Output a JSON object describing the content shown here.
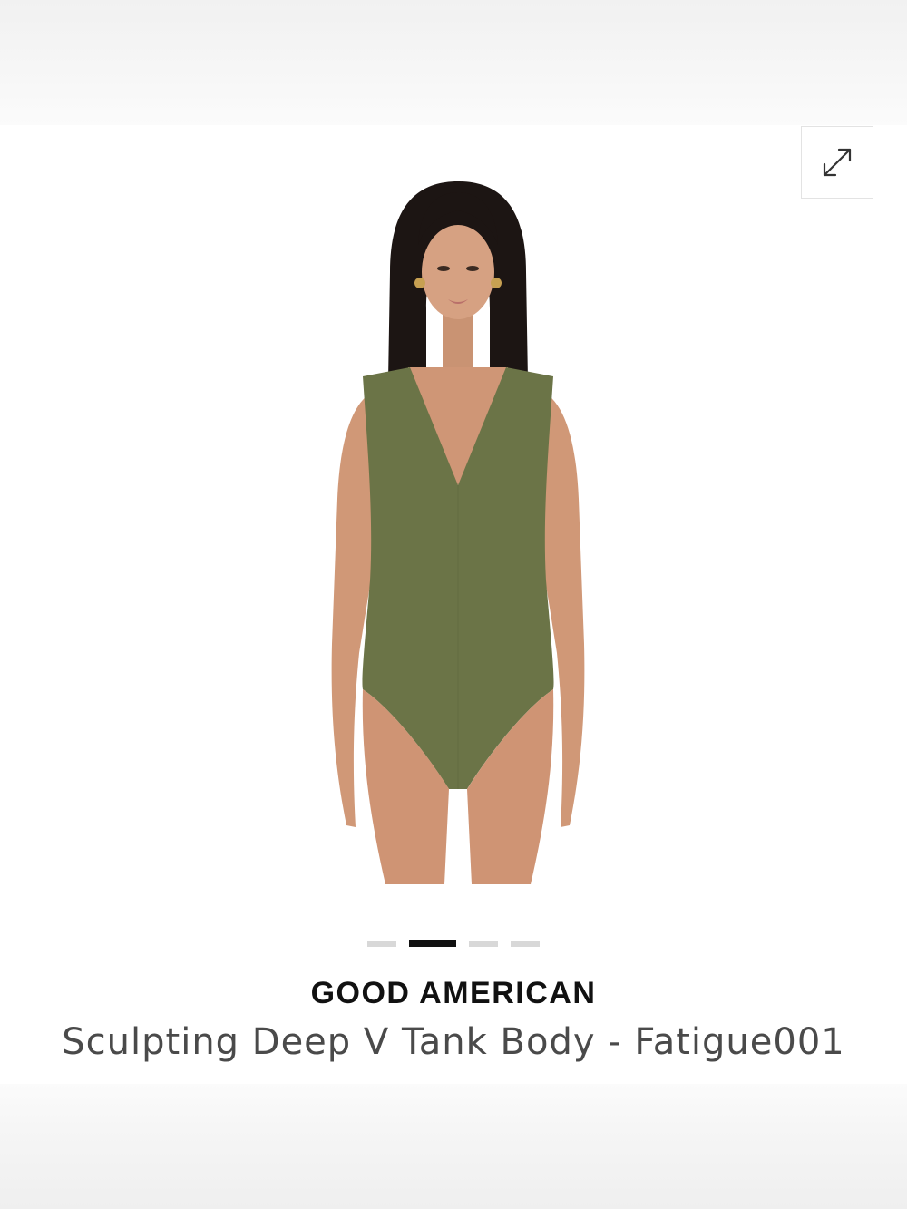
{
  "product": {
    "brand": "GOOD AMERICAN",
    "name": "Sculpting Deep V Tank Body - Fatigue001",
    "color_hex": "#6b7447"
  },
  "gallery": {
    "image_count": 4,
    "active_index": 1,
    "expand_icon": "expand-arrows-icon"
  }
}
